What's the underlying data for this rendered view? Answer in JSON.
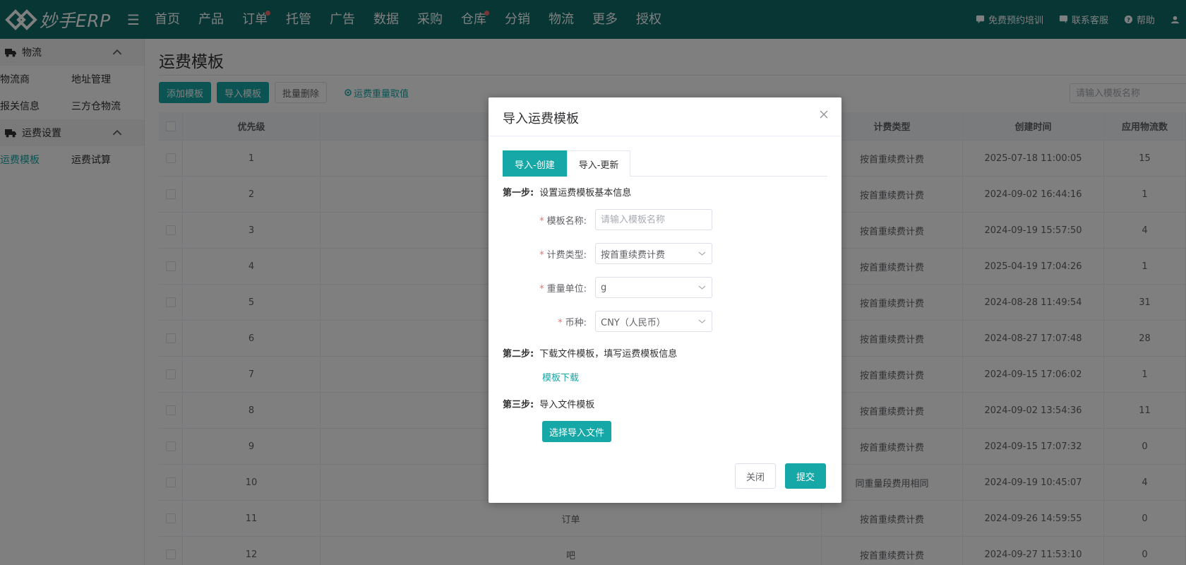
{
  "app": {
    "logo_text": "妙手ERP"
  },
  "nav": {
    "items": [
      {
        "label": "首页",
        "dot": false
      },
      {
        "label": "产品",
        "dot": false
      },
      {
        "label": "订单",
        "dot": true
      },
      {
        "label": "托管",
        "dot": false
      },
      {
        "label": "广告",
        "dot": false
      },
      {
        "label": "数据",
        "dot": false
      },
      {
        "label": "采购",
        "dot": false
      },
      {
        "label": "仓库",
        "dot": true
      },
      {
        "label": "分销",
        "dot": false
      },
      {
        "label": "物流",
        "dot": false
      },
      {
        "label": "更多",
        "dot": false
      },
      {
        "label": "授权",
        "dot": false
      }
    ],
    "right": {
      "training": "免费预约培训",
      "service": "联系客服",
      "help": "帮助"
    }
  },
  "sidebar": {
    "group1": {
      "label": "物流",
      "row1": [
        "物流商",
        "地址管理"
      ],
      "row2": [
        "报关信息",
        "三方仓物流"
      ]
    },
    "group2": {
      "label": "运费设置",
      "row1": [
        "运费模板",
        "运费试算"
      ]
    }
  },
  "page": {
    "title": "运费模板",
    "toolbar": {
      "add": "添加模板",
      "import": "导入模板",
      "batch_delete": "批量删除",
      "weight_rule": "运费重量取值"
    },
    "search_placeholder": "请输入模板名称"
  },
  "table": {
    "headers": {
      "priority": "优先级",
      "name": "",
      "type": "计费类型",
      "created": "创建时间",
      "count": "应用物流数"
    },
    "rows": [
      {
        "priority": "1",
        "name": "",
        "type": "按首重续费计费",
        "created": "2025-07-18 11:00:05",
        "count": "15"
      },
      {
        "priority": "2",
        "name": "",
        "type": "按首重续费计费",
        "created": "2024-09-02 16:44:16",
        "count": "1"
      },
      {
        "priority": "3",
        "name": "",
        "type": "按首重续费计费",
        "created": "2024-09-19 15:57:50",
        "count": "4"
      },
      {
        "priority": "4",
        "name": "",
        "type": "按首重续费计费",
        "created": "2025-04-19 17:04:26",
        "count": "1"
      },
      {
        "priority": "5",
        "name": "",
        "type": "按首重续费计费",
        "created": "2024-08-28 11:49:54",
        "count": "31"
      },
      {
        "priority": "6",
        "name": "",
        "type": "按首重续费计费",
        "created": "2024-08-27 17:07:48",
        "count": "28"
      },
      {
        "priority": "7",
        "name": "",
        "type": "按首重续费计费",
        "created": "2024-09-15 17:06:02",
        "count": "1"
      },
      {
        "priority": "8",
        "name": "",
        "type": "按首重续费计费",
        "created": "2024-09-02 13:54:36",
        "count": "11"
      },
      {
        "priority": "9",
        "name": "",
        "type": "按首重续费计费",
        "created": "2024-09-15 17:07:32",
        "count": "0"
      },
      {
        "priority": "10",
        "name": "",
        "type": "同重量段费用相同",
        "created": "2024-09-19 10:45:07",
        "count": "4"
      },
      {
        "priority": "11",
        "name": "订单",
        "type": "按首重续费计费",
        "created": "2024-09-26 14:59:55",
        "count": "0"
      },
      {
        "priority": "12",
        "name": "吧",
        "type": "按首重续费计费",
        "created": "2024-09-27 11:53:10",
        "count": "0"
      }
    ]
  },
  "dialog": {
    "title": "导入运费模板",
    "tabs": [
      "导入-创建",
      "导入-更新"
    ],
    "step1": {
      "prefix": "第一步:",
      "text": "设置运费模板基本信息"
    },
    "fields": {
      "name": {
        "label": "模板名称:",
        "placeholder": "请输入模板名称",
        "value": ""
      },
      "fee_type": {
        "label": "计费类型:",
        "value": "按首重续费计费"
      },
      "weight_unit": {
        "label": "重量单位:",
        "value": "g"
      },
      "currency": {
        "label": "币种:",
        "value": "CNY（人民币）"
      }
    },
    "step2": {
      "prefix": "第二步:",
      "text": "下载文件模板，填写运费模板信息"
    },
    "download_link": "模板下载",
    "step3": {
      "prefix": "第三步:",
      "text": "导入文件模板"
    },
    "pick_file": "选择导入文件",
    "close": "关闭",
    "submit": "提交"
  }
}
